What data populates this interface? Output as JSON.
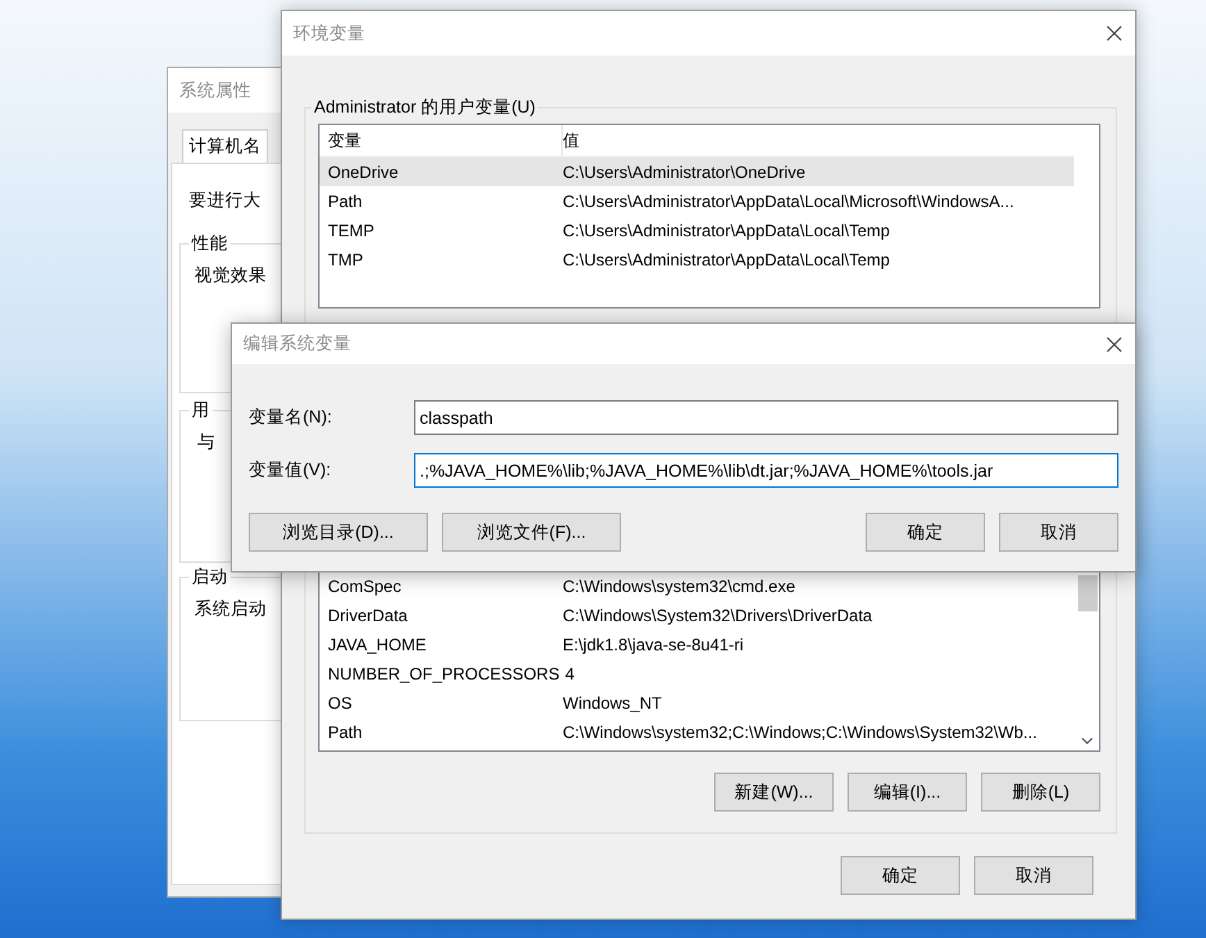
{
  "system_properties": {
    "title": "系统属性",
    "tabs": [
      {
        "label": "计算机名",
        "selected": true
      }
    ],
    "intro": "要进行大",
    "groups": [
      {
        "title": "性能",
        "text": "视觉效果"
      },
      {
        "title": "用",
        "text": "与"
      },
      {
        "title": "启动",
        "text": "系统启动"
      }
    ]
  },
  "environment_variables": {
    "title": "环境变量",
    "user_variables": {
      "title": "Administrator 的用户变量(U)",
      "columns": [
        "变量",
        "值"
      ],
      "rows": [
        {
          "name": "OneDrive",
          "value": "C:\\Users\\Administrator\\OneDrive",
          "selected": true
        },
        {
          "name": "Path",
          "value": "C:\\Users\\Administrator\\AppData\\Local\\Microsoft\\WindowsA...",
          "selected": false
        },
        {
          "name": "TEMP",
          "value": "C:\\Users\\Administrator\\AppData\\Local\\Temp",
          "selected": false
        },
        {
          "name": "TMP",
          "value": "C:\\Users\\Administrator\\AppData\\Local\\Temp",
          "selected": false
        }
      ]
    },
    "system_variables": {
      "rows": [
        {
          "name": "ComSpec",
          "value": "C:\\Windows\\system32\\cmd.exe",
          "selected": false
        },
        {
          "name": "DriverData",
          "value": "C:\\Windows\\System32\\Drivers\\DriverData",
          "selected": false
        },
        {
          "name": "JAVA_HOME",
          "value": "E:\\jdk1.8\\java-se-8u41-ri",
          "selected": false
        },
        {
          "name": "NUMBER_OF_PROCESSORS",
          "value": "4",
          "selected": false
        },
        {
          "name": "OS",
          "value": "Windows_NT",
          "selected": false
        },
        {
          "name": "Path",
          "value": "C:\\Windows\\system32;C:\\Windows;C:\\Windows\\System32\\Wb...",
          "selected": false
        }
      ],
      "buttons": [
        "新建(W)...",
        "编辑(I)...",
        "删除(L)"
      ]
    },
    "buttons": [
      "确定",
      "取消"
    ]
  },
  "edit_dialog": {
    "title": "编辑系统变量",
    "fields": [
      {
        "label": "变量名(N):",
        "value": "classpath",
        "focused": false
      },
      {
        "label": "变量值(V):",
        "value": ".;%JAVA_HOME%\\lib;%JAVA_HOME%\\lib\\dt.jar;%JAVA_HOME%\\tools.jar",
        "focused": true
      }
    ],
    "left_buttons": [
      "浏览目录(D)...",
      "浏览文件(F)..."
    ],
    "right_buttons": [
      "确定",
      "取消"
    ]
  }
}
